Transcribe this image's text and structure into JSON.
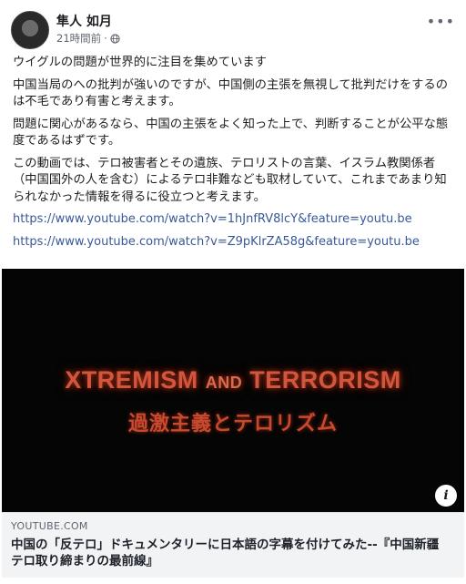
{
  "post": {
    "author": "隼人 如月",
    "time": "21時間前",
    "separator": "·",
    "more_label": "•••",
    "paragraphs": [
      "ウイグルの問題が世界的に注目を集めています",
      "中国当局のへの批判が強いのですが、中国側の主張を無視して批判だけをするのは不毛であり有害と考えます。",
      "問題に関心があるなら、中国の主張をよく知った上で、判断することが公平な態度であるはずです。",
      "この動画では、テロ被害者とその遺族、テロリストの言葉、イスラム教関係者（中国国外の人を含む）によるテロ非難なども取材していて、これまであまり知られなかった情報を得るに役立つと考えます。"
    ],
    "links": [
      "https://www.youtube.com/watch?v=1hJnfRV8lcY&feature=youtu.be",
      "https://www.youtube.com/watch?v=Z9pKlrZA58g&feature=youtu.be"
    ]
  },
  "video": {
    "title_en_part1": "XTREMISM",
    "title_en_and": "AND",
    "title_en_part2": "TERRORISM",
    "title_ja": "過激主義とテロリズム",
    "info_label": "i"
  },
  "link_card": {
    "domain": "YOUTUBE.COM",
    "title": "中国の「反テロ」ドキュメンタリーに日本語の字幕を付けてみた--『中国新疆 テロ取り締まりの最前線』"
  },
  "icons": {
    "privacy": "globe-icon",
    "more": "more-options-icon",
    "info": "info-icon"
  }
}
